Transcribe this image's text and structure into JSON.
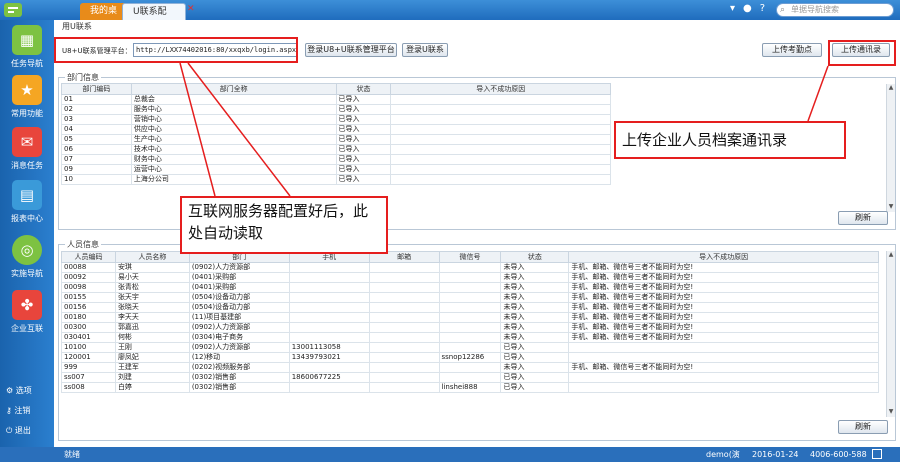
{
  "tabs": {
    "tab1": "我的桌面",
    "tab2": "U联系配置"
  },
  "search": {
    "placeholder": "单据导航搜索"
  },
  "sidebar": {
    "items": [
      {
        "label": "任务导航",
        "icon": "task-icon",
        "color": "#7dc242"
      },
      {
        "label": "常用功能",
        "icon": "star-icon",
        "color": "#f5a623"
      },
      {
        "label": "消息任务",
        "icon": "message-icon",
        "color": "#e8453c"
      },
      {
        "label": "报表中心",
        "icon": "report-icon",
        "color": "#3a9ad9"
      },
      {
        "label": "实施导航",
        "icon": "compass-icon",
        "color": "#7dc242"
      },
      {
        "label": "企业互联",
        "icon": "network-icon",
        "color": "#e8453c"
      }
    ],
    "bottom": [
      "选项",
      "注销",
      "退出"
    ]
  },
  "section": {
    "title": "用U联系"
  },
  "config": {
    "label": "U8+U联系管理平台：",
    "url": "http://LXX74402016:80/xxqxb/login.aspx",
    "login_platform_btn": "登录U8+U联系管理平台",
    "login_ulx_btn": "登录U联系",
    "upload_attendance_btn": "上传考勤点",
    "upload_contacts_btn": "上传通讯录"
  },
  "dept": {
    "group_label": "部门信息",
    "columns": [
      "部门编码",
      "部门全称",
      "状态",
      "导入不成功原因"
    ],
    "rows": [
      [
        "01",
        "总裁会",
        "已导入",
        ""
      ],
      [
        "02",
        "服务中心",
        "已导入",
        ""
      ],
      [
        "03",
        "营销中心",
        "已导入",
        ""
      ],
      [
        "04",
        "供应中心",
        "已导入",
        ""
      ],
      [
        "05",
        "生产中心",
        "已导入",
        ""
      ],
      [
        "06",
        "技术中心",
        "已导入",
        ""
      ],
      [
        "07",
        "财务中心",
        "已导入",
        ""
      ],
      [
        "09",
        "运营中心",
        "已导入",
        ""
      ],
      [
        "10",
        "上海分公司",
        "已导入",
        ""
      ]
    ],
    "refresh_btn": "刷新"
  },
  "staff": {
    "group_label": "人员信息",
    "columns": [
      "人员编码",
      "人员名称",
      "部门",
      "手机",
      "邮箱",
      "微信号",
      "状态",
      "导入不成功原因"
    ],
    "rows": [
      [
        "00088",
        "安琪",
        "(0902)人力资源部",
        "",
        "",
        "",
        "未导入",
        "手机、邮箱、微信号三者不能同时为空!"
      ],
      [
        "00092",
        "易小天",
        "(0401)采购部",
        "",
        "",
        "",
        "未导入",
        "手机、邮箱、微信号三者不能同时为空!"
      ],
      [
        "00098",
        "张青松",
        "(0401)采购部",
        "",
        "",
        "",
        "未导入",
        "手机、邮箱、微信号三者不能同时为空!"
      ],
      [
        "00155",
        "张天宇",
        "(0504)设备动力部",
        "",
        "",
        "",
        "未导入",
        "手机、邮箱、微信号三者不能同时为空!"
      ],
      [
        "00156",
        "张晓天",
        "(0504)设备动力部",
        "",
        "",
        "",
        "未导入",
        "手机、邮箱、微信号三者不能同时为空!"
      ],
      [
        "00180",
        "李天天",
        "(11)项目基建部",
        "",
        "",
        "",
        "未导入",
        "手机、邮箱、微信号三者不能同时为空!"
      ],
      [
        "00300",
        "郭嘉迅",
        "(0902)人力资源部",
        "",
        "",
        "",
        "未导入",
        "手机、邮箱、微信号三者不能同时为空!"
      ],
      [
        "030401",
        "何彬",
        "(0304)电子商务",
        "",
        "",
        "",
        "未导入",
        "手机、邮箱、微信号三者不能同时为空!"
      ],
      [
        "10100",
        "王刚",
        "(0902)人力资源部",
        "13001113058",
        "",
        "",
        "已导入",
        ""
      ],
      [
        "120001",
        "廖凤妃",
        "(12)移动",
        "13439793021",
        "",
        "ssnop12286",
        "已导入",
        ""
      ],
      [
        "999",
        "王建军",
        "(0202)视频服务部",
        "",
        "",
        "",
        "未导入",
        "手机、邮箱、微信号三者不能同时为空!"
      ],
      [
        "ss007",
        "刘建",
        "(0302)销售部",
        "18600677225",
        "",
        "",
        "已导入",
        ""
      ],
      [
        "ss008",
        "白婷",
        "(0302)销售部",
        "",
        "",
        "linshei888",
        "已导入",
        ""
      ]
    ],
    "refresh_btn": "刷新"
  },
  "annotations": {
    "upload_note": "上传企业人员档案通讯录",
    "auto_note": "互联网服务器配置好后，此处自动读取"
  },
  "statusbar": {
    "left": "就绪",
    "user": "demo(演",
    "date": "2016-01-24",
    "phone": "4006-600-588"
  }
}
